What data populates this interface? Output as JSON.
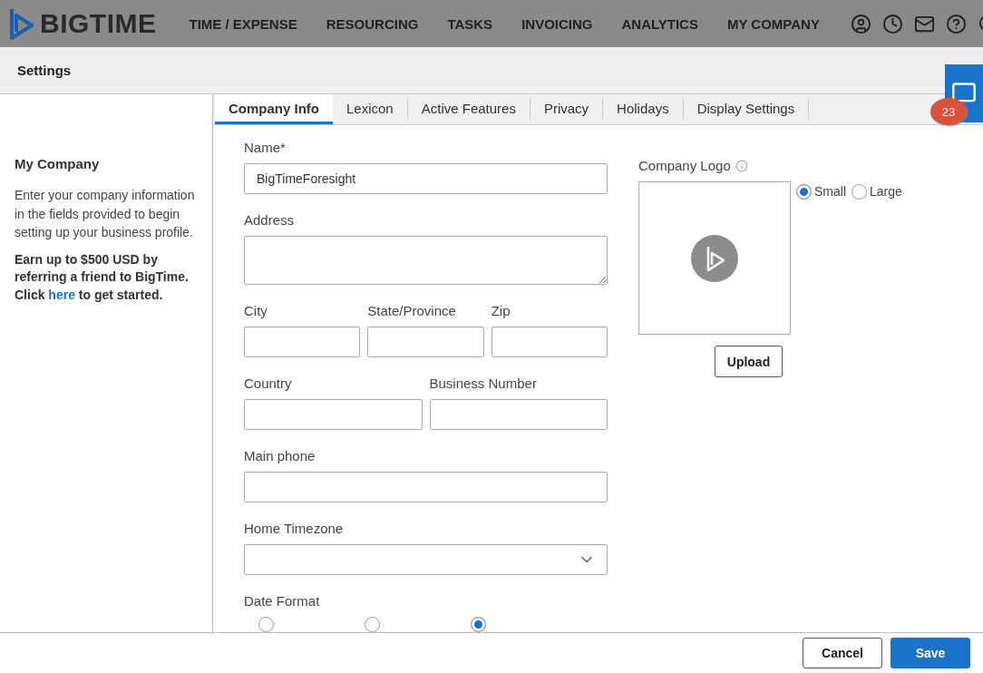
{
  "nav": {
    "logo": "BIGTIME",
    "items": [
      "TIME / EXPENSE",
      "RESOURCING",
      "TASKS",
      "INVOICING",
      "ANALYTICS",
      "MY COMPANY"
    ]
  },
  "header": {
    "title": "Settings"
  },
  "sidebar": {
    "title": "My Company",
    "description": "Enter your company information in the fields provided to begin setting up your business profile.",
    "promo_before": "Earn up to $500 USD by referring a friend to BigTime. Click",
    "link": "here",
    "promo_after": "to get started."
  },
  "tabs": [
    {
      "label": "Company Info",
      "selected": true
    },
    {
      "label": "Lexicon",
      "selected": false
    },
    {
      "label": "Active Features",
      "selected": false
    },
    {
      "label": "Privacy",
      "selected": false
    },
    {
      "label": "Holidays",
      "selected": false
    },
    {
      "label": "Display Settings",
      "selected": false
    }
  ],
  "form": [
    [
      {
        "label": "Name*",
        "kind": "text",
        "value": "BigTimeForesight"
      }
    ],
    [
      {
        "label": "Address",
        "kind": "textarea"
      }
    ],
    [
      {
        "label": "City",
        "kind": "text"
      },
      {
        "label": "State/Province",
        "kind": "text"
      },
      {
        "label": "Zip",
        "kind": "text"
      }
    ],
    [
      {
        "label": "Country",
        "kind": "text"
      },
      {
        "label": "Business Number",
        "kind": "text"
      }
    ],
    [
      {
        "label": "Main phone",
        "kind": "text"
      }
    ],
    [
      {
        "label": "Home Timezone",
        "kind": "select"
      }
    ]
  ],
  "date_format": {
    "label": "Date Format",
    "options": [
      {
        "selected": false
      },
      {
        "selected": false
      },
      {
        "selected": true
      }
    ]
  },
  "logo_panel": {
    "label": "Company Logo",
    "sizes": [
      {
        "label": "Small",
        "selected": true
      },
      {
        "label": "Large",
        "selected": false
      }
    ],
    "upload": "Upload"
  },
  "chat": {
    "badge": "23"
  },
  "footer": {
    "buttons": [
      {
        "label": "Cancel",
        "kind": "secondary"
      },
      {
        "label": "Save",
        "kind": "primary"
      }
    ]
  }
}
